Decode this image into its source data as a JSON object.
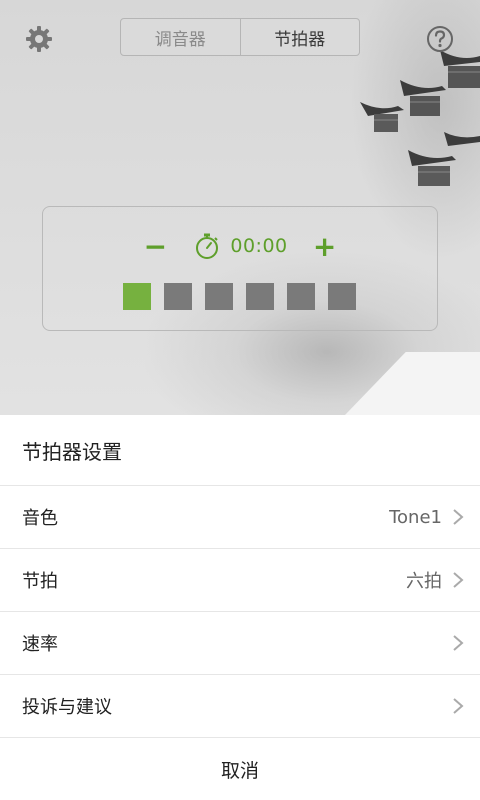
{
  "header": {
    "tabs": [
      {
        "label": "调音器",
        "active": false
      },
      {
        "label": "节拍器",
        "active": true
      }
    ],
    "settings_icon": "gear-icon",
    "help_icon": "help-circle-icon"
  },
  "metronome": {
    "minus_label": "−",
    "plus_label": "+",
    "timer": "00:00",
    "timer_icon": "stopwatch-icon",
    "beats_total": 6,
    "active_beat": 1,
    "accent_color": "#76b13f",
    "inactive_color": "#7a7a7a"
  },
  "sheet": {
    "title": "节拍器设置",
    "rows": [
      {
        "label": "音色",
        "value": "Tone1"
      },
      {
        "label": "节拍",
        "value": "六拍"
      },
      {
        "label": "速率",
        "value": ""
      },
      {
        "label": "投诉与建议",
        "value": ""
      }
    ],
    "cancel_label": "取消"
  }
}
